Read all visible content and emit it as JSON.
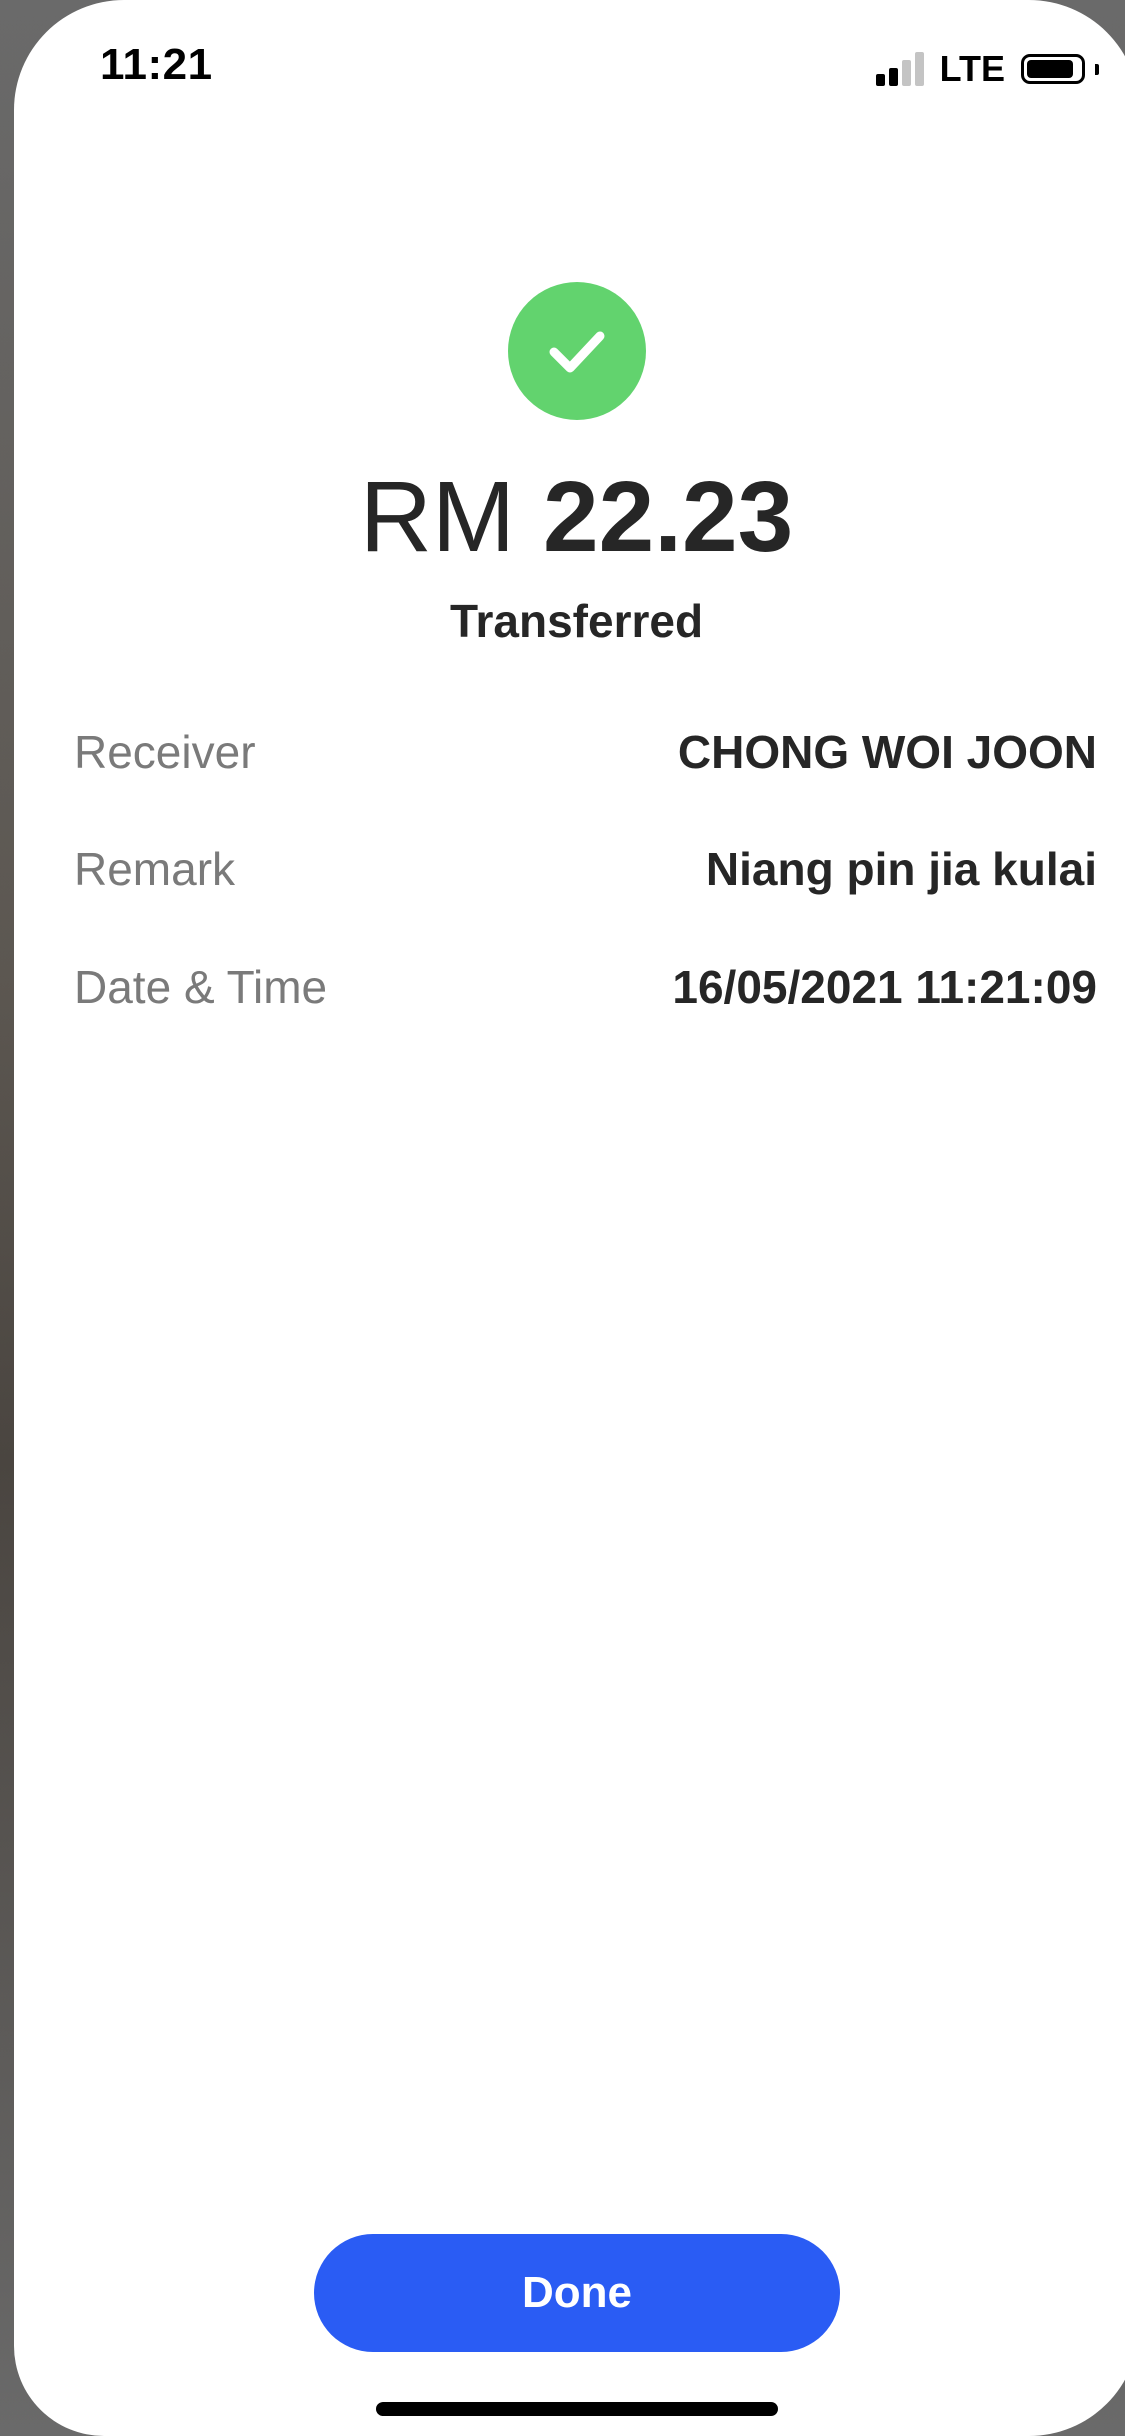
{
  "status_bar": {
    "time": "11:21",
    "network": "LTE",
    "signal_bars_active": 2,
    "signal_bars_total": 4,
    "battery_level": 0.9
  },
  "receipt": {
    "currency": "RM",
    "amount": "22.23",
    "status": "Transferred",
    "details": [
      {
        "label": "Receiver",
        "value": "CHONG WOI JOON"
      },
      {
        "label": "Remark",
        "value": "Niang pin jia kulai"
      },
      {
        "label": "Date & Time",
        "value": "16/05/2021 11:21:09"
      }
    ]
  },
  "actions": {
    "done_label": "Done"
  },
  "colors": {
    "success": "#62d36e",
    "primary": "#2a5cf4"
  }
}
